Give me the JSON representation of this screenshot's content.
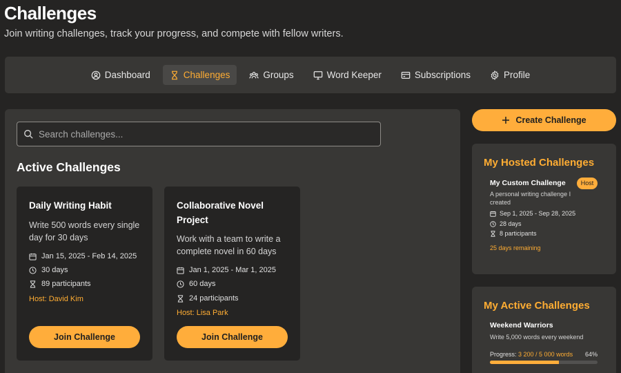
{
  "page": {
    "title": "Challenges",
    "subtitle": "Join writing challenges, track your progress, and compete with fellow writers."
  },
  "nav": {
    "items": [
      {
        "label": "Dashboard",
        "icon": "dashboard-icon"
      },
      {
        "label": "Challenges",
        "icon": "hourglass-icon",
        "active": true
      },
      {
        "label": "Groups",
        "icon": "groups-icon"
      },
      {
        "label": "Word Keeper",
        "icon": "monitor-icon"
      },
      {
        "label": "Subscriptions",
        "icon": "credit-card-icon"
      },
      {
        "label": "Profile",
        "icon": "gear-icon"
      }
    ]
  },
  "search": {
    "placeholder": "Search challenges..."
  },
  "active_section": {
    "title": "Active Challenges"
  },
  "challenges": [
    {
      "title": "Daily Writing Habit",
      "description": "Write 500 words every single day for 30 days",
      "dates": "Jan 15, 2025 - Feb 14, 2025",
      "duration": "30 days",
      "participants": "89 participants",
      "host": "Host: David Kim",
      "button": "Join Challenge"
    },
    {
      "title": "Collaborative Novel Project",
      "description": "Work with a team to write a complete novel in 60 days",
      "dates": "Jan 1, 2025 - Mar 1, 2025",
      "duration": "60 days",
      "participants": "24 participants",
      "host": "Host: Lisa Park",
      "button": "Join Challenge"
    }
  ],
  "create_button": {
    "label": "Create Challenge"
  },
  "hosted": {
    "title": "My Hosted Challenges",
    "item": {
      "name": "My Custom Challenge",
      "badge": "Host",
      "description": "A personal writing challenge I created",
      "dates": "Sep 1, 2025 - Sep 28, 2025",
      "duration": "28 days",
      "participants": "8 participants",
      "remaining": "25 days remaining"
    }
  },
  "my_active": {
    "title": "My Active Challenges",
    "item": {
      "name": "Weekend Warriors",
      "description": "Write 5,000 words every weekend",
      "progress_label": "Progress:",
      "progress_value": "3 200 / 5 000 words",
      "progress_percent": "64%",
      "progress_fraction": 0.64
    }
  },
  "colors": {
    "accent": "#ffad3b",
    "background": "#252423",
    "panel": "#383735"
  }
}
